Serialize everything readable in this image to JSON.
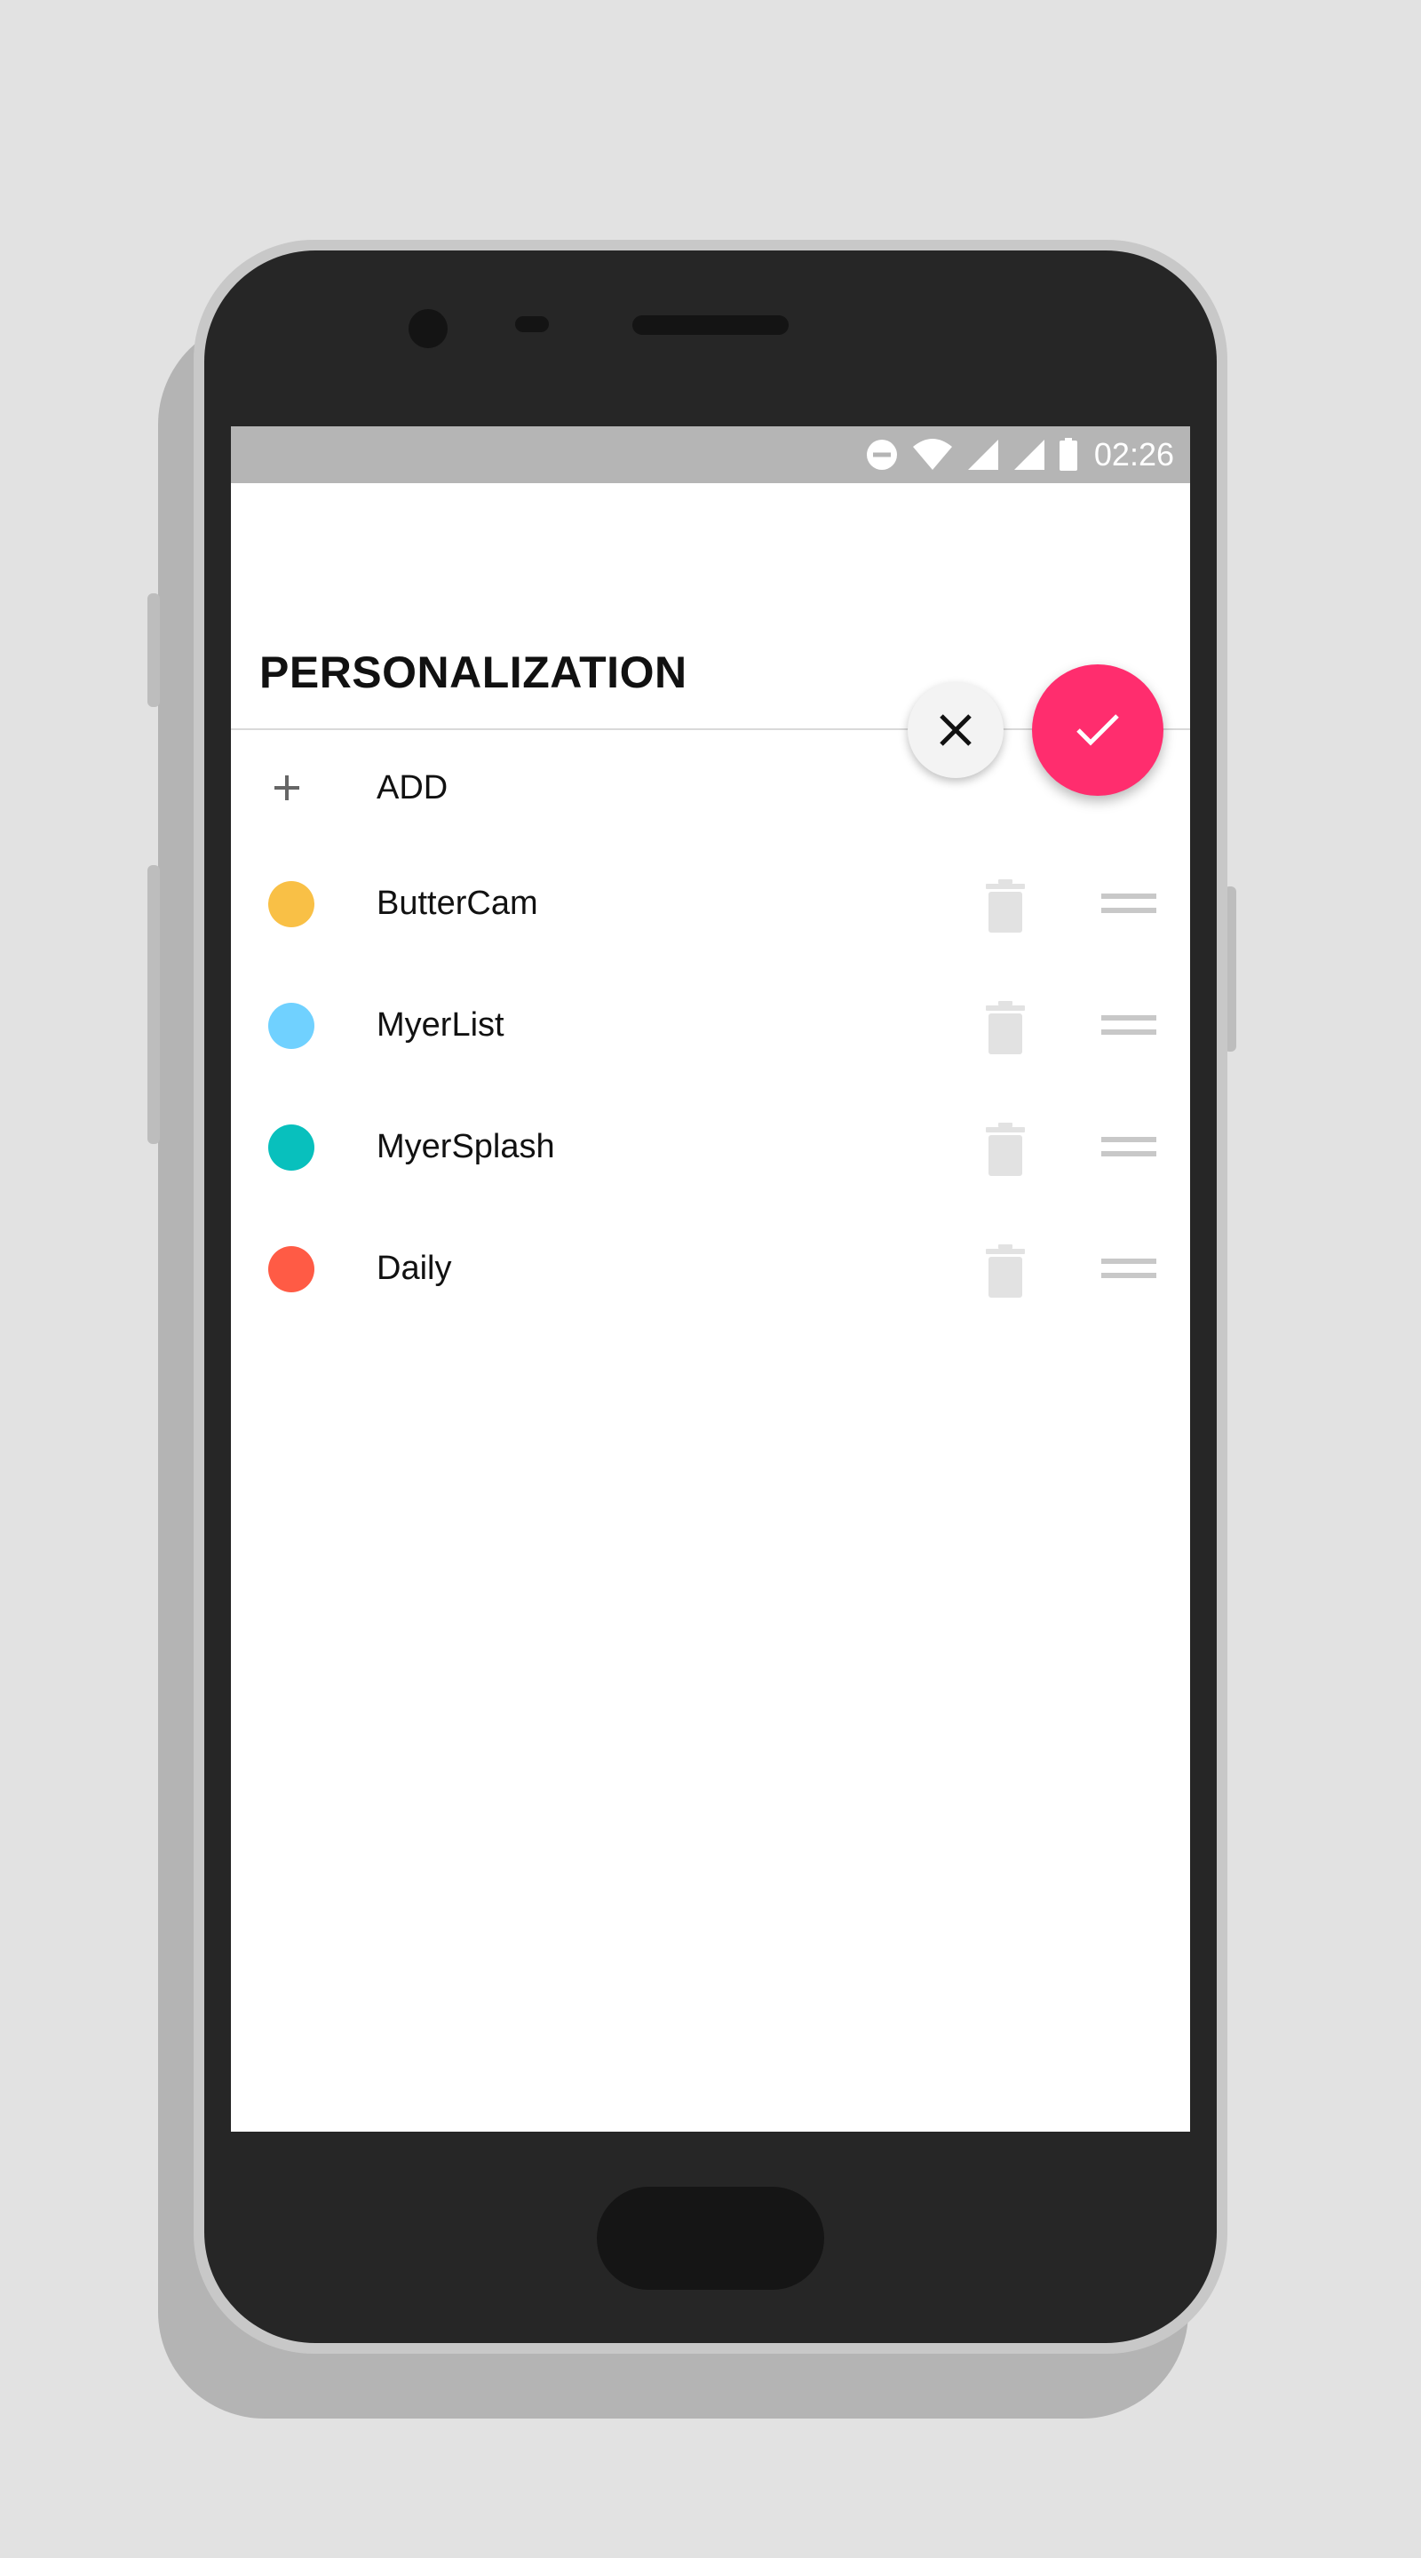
{
  "status_bar": {
    "time": "02:26",
    "icons": [
      "do-not-disturb-icon",
      "wifi-icon",
      "signal-icon",
      "signal-icon",
      "battery-icon"
    ]
  },
  "header": {
    "title": "PERSONALIZATION"
  },
  "actions": {
    "cancel_icon": "close-icon",
    "confirm_icon": "check-icon",
    "confirm_color": "#ff2d6e"
  },
  "add_row": {
    "label": "ADD",
    "icon": "plus-icon"
  },
  "items": [
    {
      "label": "ButterCam",
      "color": "#f9c046"
    },
    {
      "label": "MyerList",
      "color": "#70d1ff"
    },
    {
      "label": "MyerSplash",
      "color": "#08c0bd"
    },
    {
      "label": "Daily",
      "color": "#ff5b45"
    }
  ]
}
